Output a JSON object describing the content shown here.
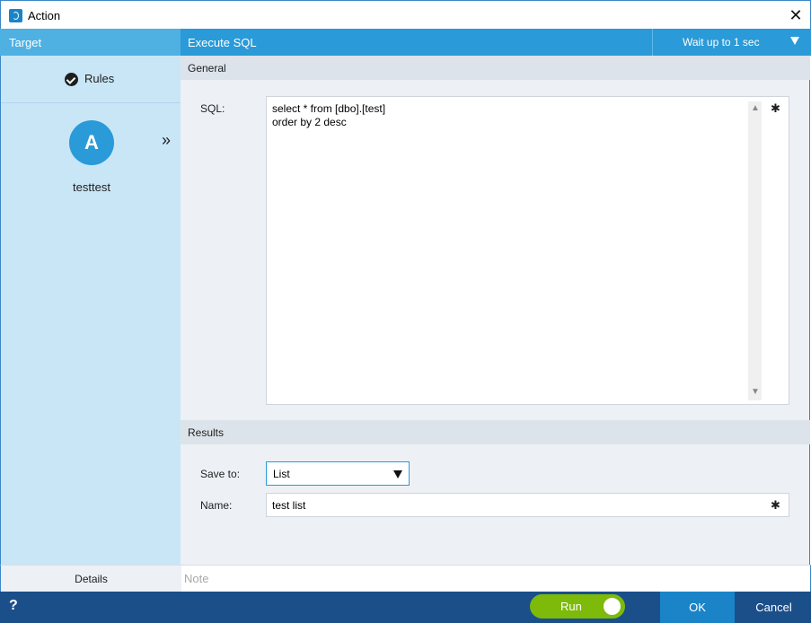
{
  "window": {
    "title": "Action",
    "close_glyph": "✕"
  },
  "header": {
    "target_label": "Target",
    "action_type": "Execute SQL",
    "wait_label": "Wait up to 1 sec"
  },
  "sidebar": {
    "rules_label": "Rules",
    "avatar_letter": "A",
    "expand_glyph": "»",
    "target_name": "testtest"
  },
  "general": {
    "header": "General",
    "sql_label": "SQL:",
    "sql_text": "select * from [dbo].[test]\norder by 2 desc"
  },
  "results": {
    "header": "Results",
    "save_to_label": "Save to:",
    "save_to_value": "List",
    "name_label": "Name:",
    "name_value": "test list"
  },
  "bottom": {
    "details_label": "Details",
    "note_placeholder": "Note"
  },
  "footer": {
    "help_glyph": "?",
    "run_label": "Run",
    "ok_label": "OK",
    "cancel_label": "Cancel"
  },
  "colors": {
    "header_blue": "#2a9ad8",
    "sidebar_bg": "#c9e6f7",
    "footer_bg": "#1a4f8a",
    "ok_blue": "#1b84c8",
    "run_green": "#7dba0a"
  },
  "icons": {
    "app": "app-logo-icon",
    "check": "check-circle-icon",
    "wand": "magic-wand-icon",
    "dropdown": "chevron-down-icon"
  }
}
